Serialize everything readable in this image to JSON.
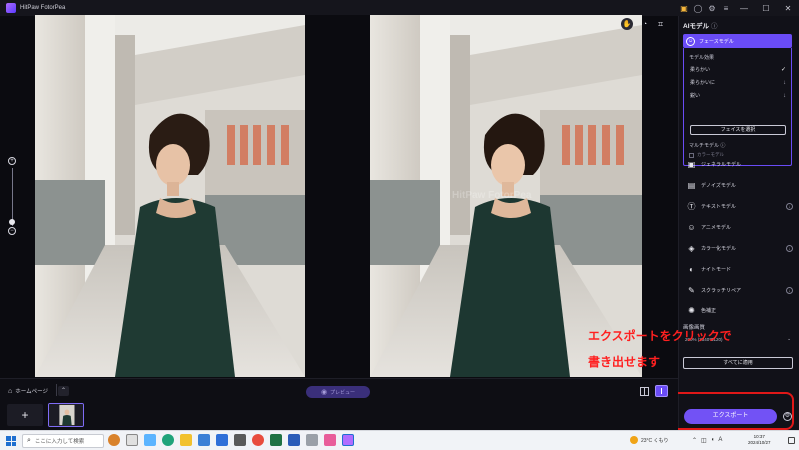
{
  "app": {
    "title": "HitPaw FotorPea"
  },
  "window_controls": {
    "minimize": "—",
    "maximize": "☐",
    "close": "✕"
  },
  "zoom": {
    "plus": "+",
    "minus": "−",
    "level": 0.15
  },
  "canvas": {
    "watermark": "HitPaw FotorPea"
  },
  "panel": {
    "title": "AIモデル",
    "info": "ⓘ",
    "active_model": {
      "label": "フェースモデル",
      "effect_label": "モデル効果",
      "options": [
        {
          "label": "柔らかい",
          "selected": true
        },
        {
          "label": "柔らかいに",
          "selected": false
        },
        {
          "label": "鋭い",
          "selected": false
        }
      ],
      "face_select_button": "フェイスを選択",
      "multi_label": "マルチモデル",
      "multi_info": "ⓘ",
      "multi_checkbox": "カラーモデル"
    },
    "models": [
      {
        "label": "ジェネラルモデル",
        "icon": "image-icon",
        "glyph": "▣",
        "download": false
      },
      {
        "label": "デノイズモデル",
        "icon": "denoise-icon",
        "glyph": "▤",
        "download": false
      },
      {
        "label": "テキストモデル",
        "icon": "text-icon",
        "glyph": "Ⓣ",
        "download": true
      },
      {
        "label": "アニメモデル",
        "icon": "anime-icon",
        "glyph": "☺",
        "download": false
      },
      {
        "label": "カラー化モデル",
        "icon": "colorize-icon",
        "glyph": "◈",
        "download": true
      },
      {
        "label": "ナイトモード",
        "icon": "night-icon",
        "glyph": "◐",
        "download": false
      },
      {
        "label": "スクラッチリペア",
        "icon": "scratch-icon",
        "glyph": "✎",
        "download": true
      },
      {
        "label": "色補正",
        "icon": "color-correct-icon",
        "glyph": "✺",
        "download": false
      }
    ],
    "resolution_label": "画像画質",
    "resolution_value": "200% (3840*5120)",
    "apply_all_button": "すべてに適用",
    "export_button": "エクスポート"
  },
  "bottom_bar": {
    "home_label": "ホームページ",
    "preview_button": "プレビュー",
    "add_button": "+"
  },
  "annotation": {
    "line1": "エクスポートをクリックで",
    "line2": "書き出せます",
    "color": "#ff2020"
  },
  "taskbar": {
    "search_placeholder": "ここに入力して検索",
    "weather": "23°C くもり",
    "time": "10:37",
    "date": "2024/10/27"
  },
  "colors": {
    "accent": "#6a4cf6",
    "background": "#0b0b10",
    "panel": "#111118"
  }
}
